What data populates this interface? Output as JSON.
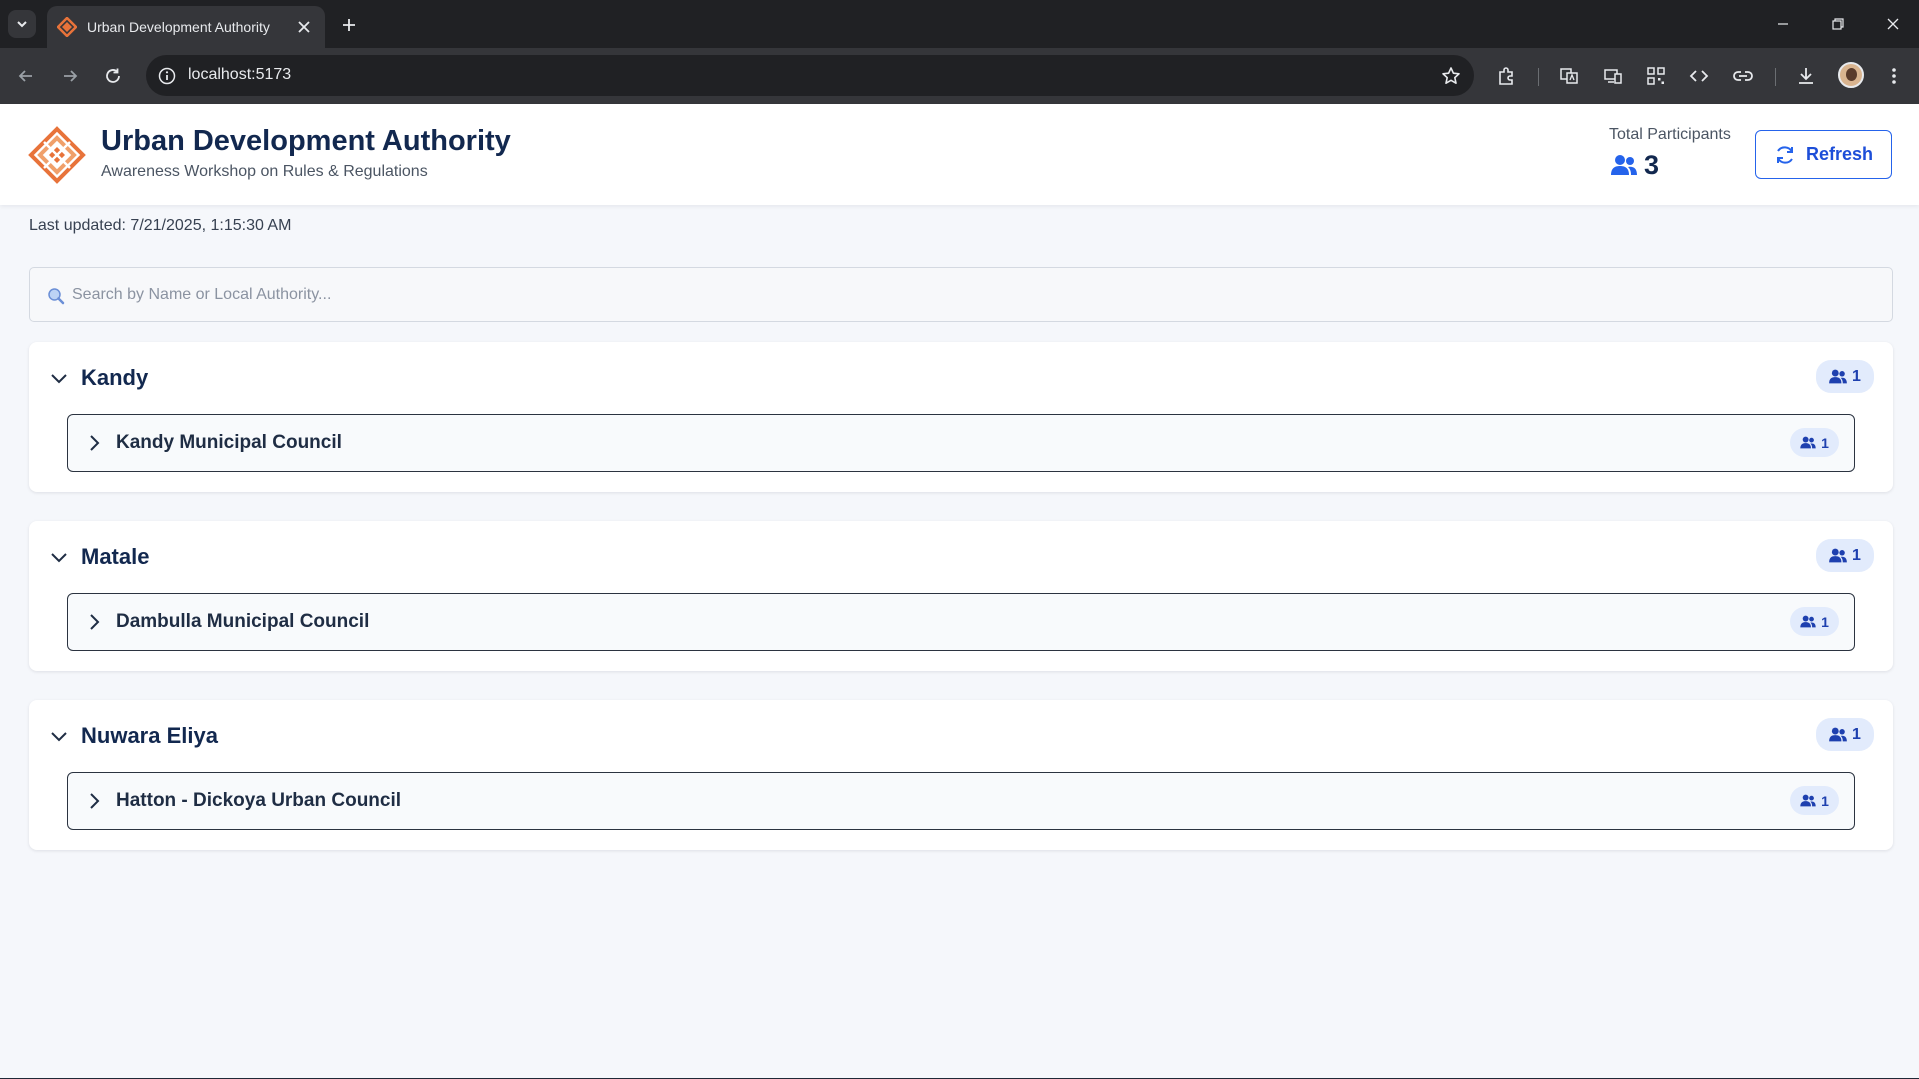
{
  "browser": {
    "tab_title": "Urban Development Authority",
    "url": "localhost:5173"
  },
  "app": {
    "title": "Urban Development Authority",
    "subtitle": "Awareness Workshop on Rules & Regulations",
    "total_participants_label": "Total Participants",
    "total_participants": "3",
    "refresh_label": "Refresh",
    "last_updated": "Last updated: 7/21/2025, 1:15:30 AM",
    "search_placeholder": "Search by Name or Local Authority...",
    "colors": {
      "brand_orange": "#e8733a",
      "accent_blue": "#2563eb",
      "navy": "#12284f"
    }
  },
  "districts": [
    {
      "name": "Kandy",
      "count": "1",
      "councils": [
        {
          "name": "Kandy Municipal Council",
          "count": "1"
        }
      ]
    },
    {
      "name": "Matale",
      "count": "1",
      "councils": [
        {
          "name": "Dambulla Municipal Council",
          "count": "1"
        }
      ]
    },
    {
      "name": "Nuwara Eliya",
      "count": "1",
      "councils": [
        {
          "name": "Hatton - Dickoya Urban Council",
          "count": "1"
        }
      ]
    }
  ]
}
